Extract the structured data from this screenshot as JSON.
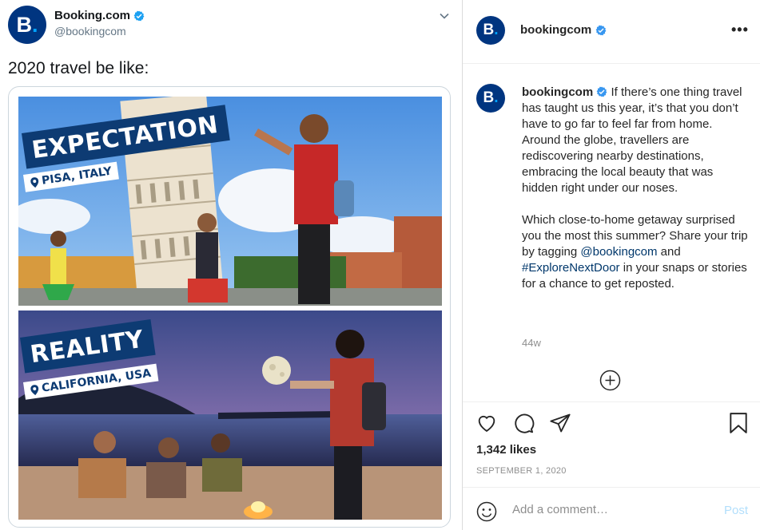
{
  "tweet": {
    "avatar_letter": "B",
    "avatar_dot": ".",
    "name": "Booking.com",
    "handle": "@bookingcom",
    "text": "2020 travel be like:",
    "icons": {
      "verified": "verified-badge-icon",
      "more": "chevron-down-icon"
    },
    "image": {
      "top_banner": "EXPECTATION",
      "top_location": "PISA, ITALY",
      "bottom_banner": "REALITY",
      "bottom_location": "CALIFORNIA, USA"
    }
  },
  "instagram": {
    "header": {
      "username": "bookingcom",
      "more": "•••"
    },
    "caption": {
      "username": "bookingcom",
      "paragraph1": "If there’s one thing travel has taught us this year, it’s that you don’t have to go far to feel far from home. Around the globe, travellers are rediscovering nearby destinations, embracing the local beauty that was hidden right under our noses.",
      "paragraph2_a": "Which close-to-home getaway surprised you the most this summer? Share your trip by tagging ",
      "mention": "@bookingcom",
      "and": " and ",
      "hashtag": "#ExploreNextDoor",
      "paragraph2_b": " in your snaps or stories for a chance to get reposted."
    },
    "age": "44w",
    "likes": "1,342 likes",
    "date": "SEPTEMBER 1, 2020",
    "comment_placeholder": "Add a comment…",
    "post_label": "Post",
    "icons": [
      "heart-icon",
      "comment-icon",
      "share-icon",
      "bookmark-icon",
      "plus-circle-icon",
      "smiley-icon"
    ]
  },
  "colors": {
    "brand_blue": "#003580",
    "verified_blue": "#3897f0",
    "link": "#00376b",
    "post_disabled": "#b2dffc"
  }
}
